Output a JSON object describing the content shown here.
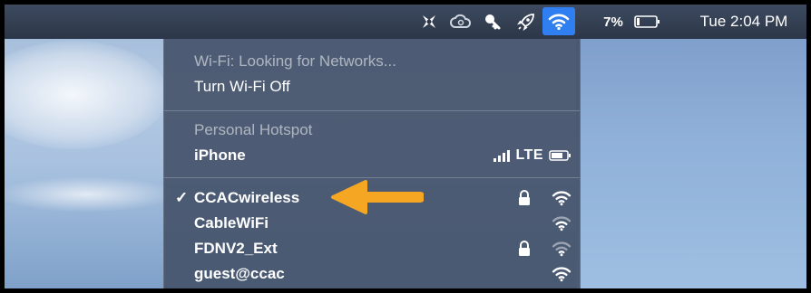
{
  "menubar": {
    "icons": [
      "app-extension-icon",
      "creative-cloud-icon",
      "spotlight-key-icon",
      "rocket-icon",
      "wifi-icon"
    ],
    "battery_percent": "7%",
    "clock": "Tue 2:04 PM"
  },
  "wifi_menu": {
    "status": "Wi-Fi: Looking for Networks...",
    "toggle_label": "Turn Wi-Fi Off",
    "hotspot_header": "Personal Hotspot",
    "hotspot_device": "iPhone",
    "hotspot_network_type": "LTE",
    "networks": [
      {
        "name": "CCACwireless",
        "connected": true,
        "locked": true
      },
      {
        "name": "CableWiFi",
        "connected": false,
        "locked": false
      },
      {
        "name": "FDNV2_Ext",
        "connected": false,
        "locked": true
      },
      {
        "name": "guest@ccac",
        "connected": false,
        "locked": false
      }
    ],
    "checkmark": "✓"
  },
  "colors": {
    "menubar_bg": "#2c3648",
    "wifi_highlight": "#2f7ff0",
    "menu_bg": "#46546c",
    "arrow": "#f5a623"
  }
}
